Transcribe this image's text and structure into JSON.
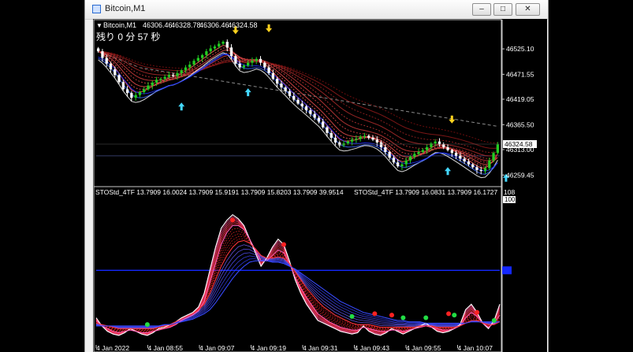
{
  "window": {
    "title": "Bitcoin,M1",
    "minimize_glyph": "–",
    "maximize_glyph": "□",
    "close_glyph": "✕"
  },
  "main_panel": {
    "symbol_label": "Bitcoin,M1",
    "ohlc": [
      "46306.46",
      "46328.78",
      "46306.46",
      "46324.58"
    ],
    "countdown": "残り 0 分 57 秒",
    "current_price": "46324.58"
  },
  "indicator_panel": {
    "label": "STOStd_4TF 13.7909 16.0024 13.7909 15.9191 13.7909 15.8203 13.7909 39.9514",
    "label2": "STOStd_4TF 13.7909 16.0831 13.7909 16.1727",
    "top_value": "108",
    "hundred_value": "100"
  },
  "chart_data": [
    {
      "type": "candlestick",
      "price_ticks": [
        46525.1,
        46471.55,
        46419.05,
        46365.5,
        46313.0,
        46259.45
      ],
      "ylim": [
        46240,
        46565
      ],
      "current_price": 46324.58,
      "closes": [
        46520,
        46506,
        46494,
        46482,
        46470,
        46455,
        46440,
        46432,
        46422,
        46428,
        46434,
        46440,
        46448,
        46454,
        46460,
        46462,
        46466,
        46470,
        46468,
        46474,
        46480,
        46486,
        46492,
        46500,
        46506,
        46512,
        46520,
        46526,
        46530,
        46536,
        46540,
        46528,
        46510,
        46494,
        46486,
        46490,
        46496,
        46500,
        46504,
        46496,
        46486,
        46474,
        46462,
        46452,
        46444,
        46436,
        46426,
        46418,
        46410,
        46404,
        46396,
        46388,
        46380,
        46372,
        46360,
        46348,
        46338,
        46328,
        46322,
        46326,
        46330,
        46334,
        46336,
        46340,
        46342,
        46338,
        46334,
        46328,
        46318,
        46308,
        46296,
        46286,
        46278,
        46282,
        46290,
        46298,
        46304,
        46308,
        46312,
        46318,
        46326,
        46330,
        46324,
        46318,
        46312,
        46306,
        46300,
        46294,
        46288,
        46282,
        46276,
        46270,
        46268,
        46274,
        46290,
        46306,
        46324
      ],
      "up_arrows": [
        {
          "i": 20,
          "price": 46412
        },
        {
          "i": 36,
          "price": 46442
        },
        {
          "i": 84,
          "price": 46276
        },
        {
          "i": 98,
          "price": 46262
        }
      ],
      "down_arrows": [
        {
          "i": 33,
          "price": 46556
        },
        {
          "i": 41,
          "price": 46560
        },
        {
          "i": 85,
          "price": 46368
        }
      ],
      "time_labels": [
        "4 Jan 2022",
        "4 Jan 08:55",
        "4 Jan 09:07",
        "4 Jan 09:19",
        "4 Jan 09:31",
        "4 Jan 09:43",
        "4 Jan 09:55",
        "4 Jan 10:07"
      ]
    },
    {
      "type": "line",
      "ylim": [
        0,
        108
      ],
      "levels": [
        100
      ],
      "series": [
        {
          "values": [
            20,
            14,
            10,
            8,
            7,
            9,
            12,
            10,
            8,
            7,
            9,
            12,
            13,
            15,
            17,
            20,
            22,
            24,
            28,
            38,
            55,
            72,
            86,
            92,
            96,
            93,
            88,
            78,
            68,
            58,
            64,
            72,
            78,
            74,
            62,
            48,
            38,
            30,
            24,
            18,
            16,
            14,
            12,
            10,
            9,
            8,
            9,
            14,
            10,
            8,
            7,
            9,
            12,
            10,
            8,
            10,
            12,
            14,
            16,
            13,
            10,
            9,
            10,
            12,
            15,
            26,
            30,
            24,
            16,
            12,
            18,
            30
          ]
        },
        {
          "values": [
            18,
            14,
            12,
            10,
            9,
            10,
            11,
            10,
            9,
            9,
            10,
            11,
            12,
            13,
            15,
            18,
            20,
            22,
            25,
            32,
            46,
            60,
            74,
            83,
            88,
            88,
            85,
            78,
            70,
            62,
            62,
            66,
            70,
            68,
            60,
            50,
            42,
            35,
            29,
            23,
            20,
            17,
            15,
            13,
            12,
            11,
            11,
            13,
            12,
            11,
            10,
            10,
            11,
            11,
            10,
            11,
            12,
            13,
            14,
            13,
            12,
            11,
            11,
            12,
            14,
            20,
            24,
            21,
            16,
            13,
            16,
            22
          ]
        },
        {
          "values": [
            16,
            15,
            14,
            13,
            12,
            12,
            12,
            12,
            12,
            12,
            12,
            13,
            14,
            15,
            17,
            19,
            21,
            23,
            26,
            30,
            38,
            48,
            58,
            66,
            72,
            76,
            77,
            75,
            71,
            66,
            64,
            64,
            65,
            64,
            60,
            54,
            48,
            42,
            37,
            32,
            28,
            25,
            22,
            20,
            18,
            16,
            15,
            15,
            15,
            14,
            13,
            13,
            13,
            13,
            13,
            13,
            13,
            14,
            14,
            14,
            13,
            13,
            13,
            13,
            14,
            16,
            18,
            18,
            16,
            15,
            15,
            17
          ]
        },
        {
          "values": [
            14,
            14,
            14,
            14,
            14,
            14,
            14,
            14,
            14,
            14,
            14,
            14,
            15,
            15,
            16,
            17,
            18,
            19,
            21,
            23,
            26,
            31,
            37,
            43,
            49,
            54,
            58,
            61,
            62,
            62,
            62,
            61,
            61,
            60,
            58,
            56,
            53,
            50,
            47,
            44,
            41,
            38,
            35,
            32,
            30,
            28,
            26,
            24,
            23,
            22,
            21,
            20,
            19,
            18,
            18,
            17,
            17,
            17,
            16,
            16,
            16,
            16,
            16,
            16,
            16,
            16,
            17,
            17,
            17,
            17,
            17,
            17
          ]
        }
      ],
      "red_dots": [
        {
          "i": 24,
          "v": 92
        },
        {
          "i": 33,
          "v": 74
        },
        {
          "i": 49,
          "v": 23
        },
        {
          "i": 52,
          "v": 22
        },
        {
          "i": 62,
          "v": 23
        },
        {
          "i": 67,
          "v": 24
        }
      ],
      "green_dots": [
        {
          "i": 9,
          "v": 15
        },
        {
          "i": 45,
          "v": 21
        },
        {
          "i": 54,
          "v": 20
        },
        {
          "i": 58,
          "v": 20
        },
        {
          "i": 63,
          "v": 22
        },
        {
          "i": 70,
          "v": 18
        }
      ],
      "blue_level": 55
    }
  ]
}
